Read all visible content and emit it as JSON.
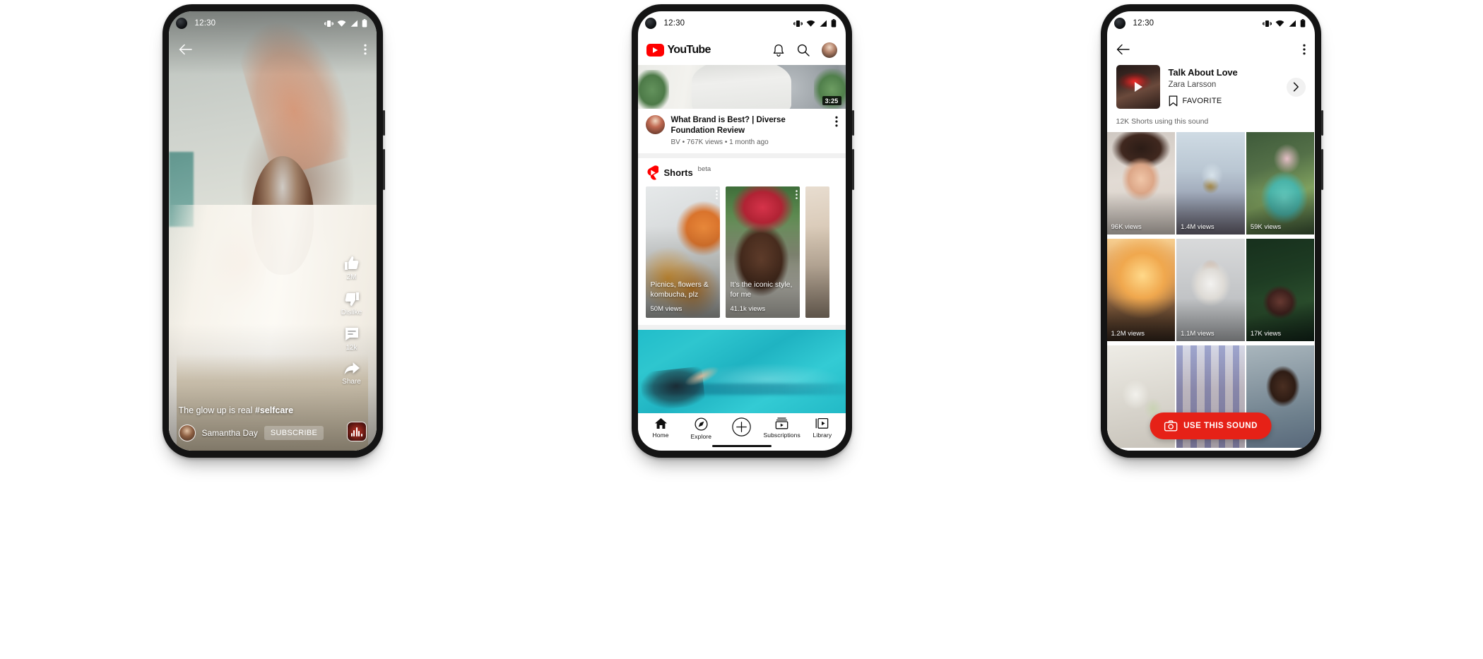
{
  "status_bar": {
    "time": "12:30",
    "icons": [
      "vibrate-icon",
      "wifi-icon",
      "signal-icon",
      "battery-icon"
    ]
  },
  "phone1": {
    "name": "YouTube Shorts player",
    "topbar": {
      "back": "back-arrow-icon",
      "more": "more-vertical-icon"
    },
    "rail": [
      {
        "icon": "thumbs-up-icon",
        "label": "2M"
      },
      {
        "icon": "thumbs-down-icon",
        "label": "Dislike"
      },
      {
        "icon": "comment-icon",
        "label": "12k"
      },
      {
        "icon": "share-icon",
        "label": "Share"
      }
    ],
    "caption_prefix": "The glow up is real ",
    "caption_tag": "#selfcare",
    "channel": "Samantha Day",
    "subscribe_label": "SUBSCRIBE",
    "sound_disc": "sound-disc-icon"
  },
  "phone2": {
    "name": "YouTube home feed",
    "header": {
      "logo_word": "YouTube",
      "bell": "notifications-bell-icon",
      "search": "search-icon",
      "avatar": "account-avatar"
    },
    "video": {
      "duration": "3:25",
      "title": "What Brand is Best? | Diverse Foundation Review",
      "subtitle": "BV • 767K views • 1 month ago"
    },
    "shorts_shelf": {
      "title": "Shorts",
      "badge": "beta",
      "cards": [
        {
          "title": "Picnics, flowers & kombucha, plz",
          "views": "50M views"
        },
        {
          "title": "It’s the iconic style, for me",
          "views": "41.1k views"
        },
        {
          "title": "",
          "views": ""
        }
      ]
    },
    "bottom_nav": [
      {
        "icon": "home-icon",
        "label": "Home"
      },
      {
        "icon": "explore-compass-icon",
        "label": "Explore"
      },
      {
        "icon": "create-plus-icon",
        "label": ""
      },
      {
        "icon": "subscriptions-icon",
        "label": "Subscriptions"
      },
      {
        "icon": "library-icon",
        "label": "Library"
      }
    ]
  },
  "phone3": {
    "name": "Shorts sound detail page",
    "topbar": {
      "back": "back-arrow-icon",
      "more": "more-vertical-icon"
    },
    "sound": {
      "title": "Talk About Love",
      "artist": "Zara Larsson",
      "favorite_label": "FAVORITE",
      "favorite_icon": "bookmark-icon",
      "chevron": "chevron-right-icon",
      "play": "play-icon",
      "count": "12K Shorts using this sound"
    },
    "grid": [
      {
        "views": "96K views"
      },
      {
        "views": "1.4M views"
      },
      {
        "views": "59K views"
      },
      {
        "views": "1.2M views"
      },
      {
        "views": "1.1M views"
      },
      {
        "views": "17K views"
      },
      {
        "views": ""
      },
      {
        "views": ""
      },
      {
        "views": ""
      }
    ],
    "cta": {
      "label": "USE THIS SOUND",
      "icon": "camera-icon"
    }
  },
  "colors": {
    "youtube_red": "#ff0000",
    "cta_red": "#e62117",
    "text_primary": "#0f0f0f",
    "text_secondary": "#606060",
    "page_bg": "#ffffff"
  }
}
